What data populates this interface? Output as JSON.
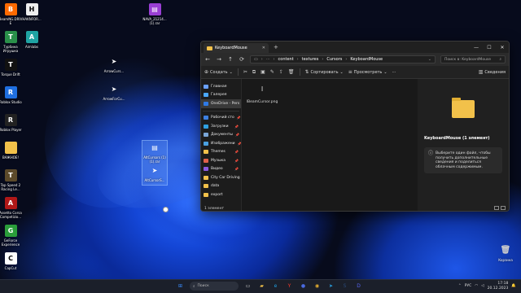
{
  "desktop": {
    "icons_left": [
      {
        "label": "BeamNG.DRIVE",
        "color": "#ff6a00",
        "glyph": "B"
      },
      {
        "label": "Турбина Игрушка",
        "color": "#2a8f4a",
        "glyph": "T"
      },
      {
        "label": "Torque Drift",
        "color": "#111111",
        "glyph": "T"
      },
      {
        "label": "Roblox Studio",
        "color": "#1f6fe0",
        "glyph": "R"
      },
      {
        "label": "Roblox Player",
        "color": "#222222",
        "glyph": "R"
      },
      {
        "label": "ВАЖНОЕ!",
        "color": "#f2c14a",
        "glyph": ""
      },
      {
        "label": "Top Speed 2 Racing Le...",
        "color": "#5c4a2a",
        "glyph": "T"
      },
      {
        "label": "Assetto Corsa Competizio...",
        "color": "#b01818",
        "glyph": "A"
      },
      {
        "label": "GeForce Experience",
        "color": "#2a9d3a",
        "glyph": "G"
      },
      {
        "label": "CapCut",
        "color": "#ffffff",
        "glyph": "C"
      }
    ],
    "icons_col2": [
      {
        "label": "HAKNFOR...",
        "color": "#eeeeee",
        "glyph": "H"
      },
      {
        "label": "Aimlabs",
        "color": "#1fa3a3",
        "glyph": "A"
      }
    ],
    "icons_mid": [
      {
        "label": "ArrowCurs...",
        "glyph": "➤"
      },
      {
        "label": "ArrowForCu...",
        "glyph": "➤"
      }
    ],
    "rar_icon": {
      "label": "NAVA_21214... (1).rar",
      "color": "#9a3fd4"
    },
    "selected_icons": [
      {
        "label": "AltCursors (1) (1).rar",
        "glyph": "▤"
      },
      {
        "label": "AltCursorS...",
        "glyph": "➤"
      }
    ],
    "recycle_bin": {
      "label": "Корзина",
      "glyph": "🗑"
    }
  },
  "explorer": {
    "tab_title": "KeyboardMouse",
    "new_tab": "+",
    "window_controls": [
      "—",
      "☐",
      "✕"
    ],
    "nav_buttons": [
      "←",
      "→",
      "↑",
      "⟳"
    ],
    "breadcrumbs": [
      "content",
      "textures",
      "Cursors",
      "KeyboardMouse"
    ],
    "search_placeholder": "Поиск в: KeyboardMouse",
    "commands": {
      "create": "Создать",
      "sort": "Сортировать",
      "view": "Просмотреть",
      "more": "···",
      "details": "Сведения"
    },
    "sidebar": [
      {
        "label": "Главная",
        "color": "#6aa0ff",
        "pin": false
      },
      {
        "label": "Галерея",
        "color": "#4aa8ff",
        "pin": false
      },
      {
        "label": "OneDrive - Pers",
        "color": "#2f7ae5",
        "pin": false,
        "selected": true
      },
      {
        "divider": true
      },
      {
        "label": "Рабочий сто",
        "color": "#3d7fe0",
        "pin": true
      },
      {
        "label": "Загрузки",
        "color": "#2fa0e0",
        "pin": true
      },
      {
        "label": "Документы",
        "color": "#7aa6d8",
        "pin": true
      },
      {
        "label": "Изображени",
        "color": "#4aa0e0",
        "pin": true
      },
      {
        "label": "Themes",
        "color": "#f2c14a",
        "pin": true
      },
      {
        "label": "Музыка",
        "color": "#e0604a",
        "pin": true
      },
      {
        "label": "Видео",
        "color": "#8a5ae0",
        "pin": true
      },
      {
        "label": "City Car Driving",
        "color": "#f2c14a",
        "pin": false
      },
      {
        "label": "data",
        "color": "#f2c14a",
        "pin": false
      },
      {
        "label": "export",
        "color": "#f2c14a",
        "pin": false
      }
    ],
    "status": "1 элемент",
    "file": {
      "name": "IBeamCursor.png",
      "glyph": "I"
    },
    "details_pane": {
      "title": "KeyboardMouse (1 элемент)",
      "info": "Выберите один файл, чтобы получить дополнительные сведения и поделиться облачным содержимым."
    }
  },
  "taskbar": {
    "search_placeholder": "Поиск",
    "apps": [
      {
        "name": "start",
        "color": "#3a8dff",
        "glyph": "⊞"
      },
      {
        "name": "taskview",
        "color": "#cccccc",
        "glyph": "▭"
      },
      {
        "name": "file-explorer",
        "color": "#f2c14a",
        "glyph": "▰"
      },
      {
        "name": "edge",
        "color": "#1fa0e0",
        "glyph": "e"
      },
      {
        "name": "yandex",
        "color": "#ff3a2a",
        "glyph": "Y"
      },
      {
        "name": "app-blue",
        "color": "#4a6ae0",
        "glyph": "●"
      },
      {
        "name": "chrome",
        "color": "#e8b030",
        "glyph": "◉"
      },
      {
        "name": "telegram",
        "color": "#2aa0e0",
        "glyph": "➤"
      },
      {
        "name": "steam",
        "color": "#2a4a7a",
        "glyph": "S"
      },
      {
        "name": "discord",
        "color": "#5865f2",
        "glyph": "D"
      }
    ],
    "tray": {
      "lang": "РУС",
      "time": "17:18",
      "date": "20.12.2023"
    }
  }
}
